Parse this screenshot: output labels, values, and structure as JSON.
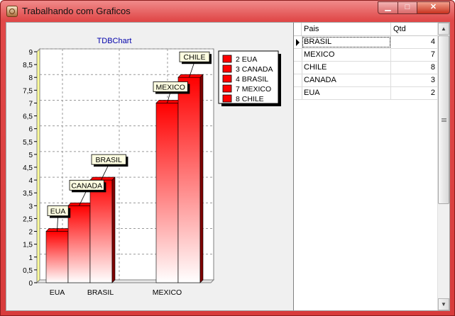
{
  "window": {
    "title": "Trabalhando com Graficos",
    "min_glyph": "▁",
    "max_glyph": "□",
    "close_glyph": "✕",
    "app_icon": "chart-app-icon"
  },
  "colors": {
    "bar_top": "#ff0000",
    "bar_bottom": "#ffffff",
    "bar_side": "#800000",
    "axis_left": "#ffff99",
    "chart_title": "#0000aa"
  },
  "grid": {
    "columns": [
      "Pais",
      "Qtd"
    ],
    "rows": [
      {
        "pais": "BRASIL",
        "qtd": "4"
      },
      {
        "pais": "MEXICO",
        "qtd": "7"
      },
      {
        "pais": "CHILE",
        "qtd": "8"
      },
      {
        "pais": "CANADA",
        "qtd": "3"
      },
      {
        "pais": "EUA",
        "qtd": "2"
      }
    ],
    "selected_row": 0
  },
  "chart_data": {
    "type": "bar",
    "title": "TDBChart",
    "categories": [
      "EUA",
      "CANADA",
      "BRASIL",
      "MEXICO",
      "CHILE"
    ],
    "x_tick_labels": [
      "EUA",
      "",
      "BRASIL",
      "MEXICO",
      ""
    ],
    "values": [
      2,
      3,
      4,
      7,
      8
    ],
    "ylim": [
      0,
      9
    ],
    "y_ticks": [
      "0",
      "0,5",
      "1",
      "1,5",
      "2",
      "2,5",
      "3",
      "3,5",
      "4",
      "4,5",
      "5",
      "5,5",
      "6",
      "6,5",
      "7",
      "7,5",
      "8",
      "8,5",
      "9"
    ],
    "legend": [
      "2 EUA",
      "3 CANADA",
      "4 BRASIL",
      "7 MEXICO",
      "8 CHILE"
    ],
    "legend_position": "top-right",
    "grid": true
  }
}
